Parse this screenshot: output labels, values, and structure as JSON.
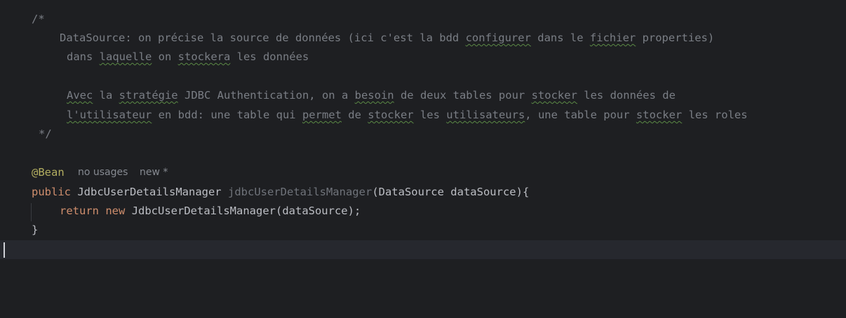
{
  "editor": {
    "comment": {
      "open": "/*",
      "l1_a": "DataSource: on précise la source de données (ici c'est la bdd ",
      "l1_b": "configurer",
      "l1_c": " dans le ",
      "l1_d": "fichier",
      "l1_e": " properties)",
      "l2_a": "dans ",
      "l2_b": "laquelle",
      "l2_c": " on ",
      "l2_d": "stockera",
      "l2_e": " les données",
      "l4_a": "Avec",
      "l4_b": " la ",
      "l4_c": "stratégie",
      "l4_d": " JDBC Authentication, on a ",
      "l4_e": "besoin",
      "l4_f": " de deux tables pour ",
      "l4_g": "stocker",
      "l4_h": " les données de",
      "l5_a": "l'utilisateur",
      "l5_b": " en bdd: une table qui ",
      "l5_c": "permet",
      "l5_d": " de ",
      "l5_e": "stocker",
      "l5_f": " les ",
      "l5_g": "utilisateurs",
      "l5_h": ", une table pour ",
      "l5_i": "stocker",
      "l5_j": " les roles",
      "close": "*/"
    },
    "annotation": "@Bean",
    "hint_usages": "no usages",
    "hint_new": "new *",
    "sig_public": "public",
    "sig_type": "JdbcUserDetailsManager",
    "sig_method": "jdbcUserDetailsManager",
    "sig_params": "(DataSource dataSource){",
    "ret_return": "return",
    "ret_new": "new",
    "ret_rest": "JdbcUserDetailsManager(dataSource);",
    "close_brace": "}"
  }
}
